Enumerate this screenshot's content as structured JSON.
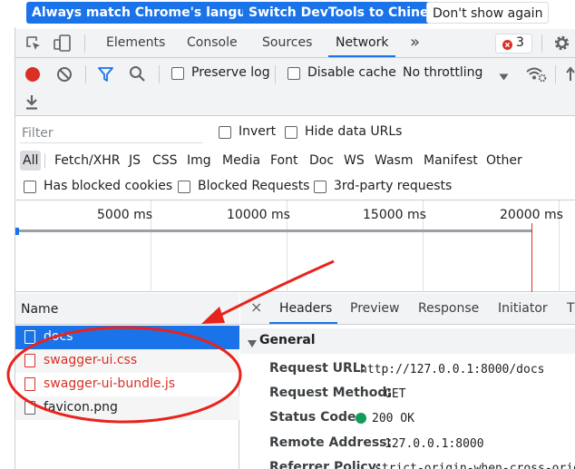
{
  "infobar": {
    "match_language": "Always match Chrome's language",
    "switch_chinese": "Switch DevTools to Chinese",
    "dont_show": "Don't show again"
  },
  "tabs": {
    "elements": "Elements",
    "console": "Console",
    "sources": "Sources",
    "network": "Network",
    "more": "»",
    "error_count": "3"
  },
  "toolbar": {
    "preserve_log": "Preserve log",
    "disable_cache": "Disable cache",
    "throttling": "No throttling"
  },
  "filter": {
    "placeholder": "Filter",
    "invert": "Invert",
    "hide_data_urls": "Hide data URLs",
    "types": [
      "All",
      "Fetch/XHR",
      "JS",
      "CSS",
      "Img",
      "Media",
      "Font",
      "Doc",
      "WS",
      "Wasm",
      "Manifest",
      "Other"
    ],
    "has_blocked_cookies": "Has blocked cookies",
    "blocked_requests": "Blocked Requests",
    "third_party": "3rd-party requests"
  },
  "timeline": {
    "ticks": [
      "5000 ms",
      "10000 ms",
      "15000 ms",
      "20000 ms"
    ]
  },
  "requests": {
    "header": "Name",
    "items": [
      {
        "name": "docs"
      },
      {
        "name": "swagger-ui.css"
      },
      {
        "name": "swagger-ui-bundle.js"
      },
      {
        "name": "favicon.png"
      }
    ]
  },
  "details": {
    "close": "×",
    "tabs": [
      "Headers",
      "Preview",
      "Response",
      "Initiator",
      "T"
    ],
    "section": "General",
    "rows": [
      {
        "key": "Request URL:",
        "value": "http://127.0.0.1:8000/docs"
      },
      {
        "key": "Request Method:",
        "value": "GET"
      },
      {
        "key": "Status Code:",
        "value": "200 OK"
      },
      {
        "key": "Remote Address:",
        "value": "127.0.0.1:8000"
      },
      {
        "key": "Referrer Policy:",
        "value": "strict-origin-when-cross-origin"
      }
    ]
  },
  "colors": {
    "accent": "#1a73e8",
    "record": "#d93025",
    "status_ok": "#0f9d58",
    "annotation": "#e8231c"
  }
}
